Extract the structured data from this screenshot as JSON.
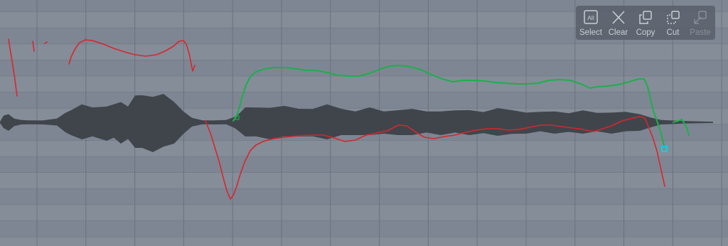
{
  "toolbar": {
    "select_label": "Select",
    "select_icon_text": "All",
    "clear_label": "Clear",
    "copy_label": "Copy",
    "cut_label": "Cut",
    "paste_label": "Paste",
    "paste_enabled": false
  },
  "colors": {
    "background": "#7d8592",
    "waveform": "#40454c",
    "pitch_original": "#d8262c",
    "pitch_edited": "#1bb04a",
    "selection_handle": "#00d8ff"
  },
  "icons": {
    "select": "select-all-icon",
    "clear": "x-icon",
    "copy": "copy-icon",
    "cut": "cut-icon",
    "paste": "paste-icon"
  }
}
